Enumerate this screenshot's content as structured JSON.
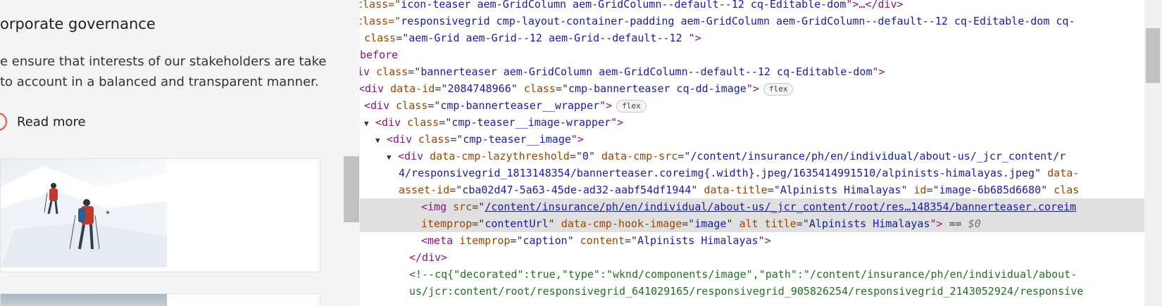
{
  "page": {
    "heading": "orporate governance",
    "paragraph_lines": [
      "e ensure that interests of our stakeholders are taken",
      "to account in a balanced and transparent manner."
    ],
    "read_more": "Read more"
  },
  "devtools": {
    "lines": [
      {
        "parts": [
          {
            "text": "class=\"",
            "cls": "attr"
          },
          {
            "text": "icon-teaser aem-GridColumn aem-GridColumn--default--12 cq-Editable-dom",
            "cls": "val"
          },
          {
            "text": "\">…</div>",
            "cls": "tag"
          }
        ]
      },
      {
        "parts": [
          {
            "text": "class=\"",
            "cls": "attr"
          },
          {
            "text": "responsivegrid cmp-layout-container-padding aem-GridColumn aem-GridColumn--default--12 cq-Editable-dom cq-",
            "cls": "val"
          }
        ]
      },
      {
        "parts": [
          {
            "text": "v ",
            "cls": "tag"
          },
          {
            "text": "class",
            "cls": "attr"
          },
          {
            "text": "=\"",
            "cls": "plain"
          },
          {
            "text": "aem-Grid aem-Grid--12 aem-Grid--default--12 ",
            "cls": "val"
          },
          {
            "text": "\">",
            "cls": "tag"
          }
        ]
      },
      {
        "parts": [
          {
            "text": "before",
            "cls": "pseudo"
          }
        ]
      },
      {
        "parts": [
          {
            "text": "iv ",
            "cls": "tag"
          },
          {
            "text": "class",
            "cls": "attr"
          },
          {
            "text": "=\"",
            "cls": "plain"
          },
          {
            "text": "bannerteaser aem-GridColumn aem-GridColumn--default--12 cq-Editable-dom",
            "cls": "val"
          },
          {
            "text": "\">",
            "cls": "tag"
          }
        ]
      },
      {
        "parts": [
          {
            "text": "<div ",
            "cls": "tag"
          },
          {
            "text": "data-id",
            "cls": "attr"
          },
          {
            "text": "=\"",
            "cls": "plain"
          },
          {
            "text": "2084748966",
            "cls": "val"
          },
          {
            "text": "\" ",
            "cls": "plain"
          },
          {
            "text": "class",
            "cls": "attr"
          },
          {
            "text": "=\"",
            "cls": "plain"
          },
          {
            "text": "cmp-bannerteaser cq-dd-image",
            "cls": "val"
          },
          {
            "text": "\">",
            "cls": "tag"
          }
        ],
        "badge": "flex"
      },
      {
        "tri": "▼",
        "parts": [
          {
            "text": "<div ",
            "cls": "tag"
          },
          {
            "text": "class",
            "cls": "attr"
          },
          {
            "text": "=\"",
            "cls": "plain"
          },
          {
            "text": "cmp-bannerteaser__wrapper",
            "cls": "val"
          },
          {
            "text": "\">",
            "cls": "tag"
          }
        ],
        "badge": "flex"
      },
      {
        "tri": "▼",
        "parts": [
          {
            "text": "<div ",
            "cls": "tag"
          },
          {
            "text": "class",
            "cls": "attr"
          },
          {
            "text": "=\"",
            "cls": "plain"
          },
          {
            "text": "cmp-teaser__image-wrapper",
            "cls": "val"
          },
          {
            "text": "\">",
            "cls": "tag"
          }
        ]
      },
      {
        "tri": "▼",
        "parts": [
          {
            "text": "<div ",
            "cls": "tag"
          },
          {
            "text": "class",
            "cls": "attr"
          },
          {
            "text": "=\"",
            "cls": "plain"
          },
          {
            "text": "cmp-teaser__image",
            "cls": "val"
          },
          {
            "text": "\">",
            "cls": "tag"
          }
        ]
      },
      {
        "tri": "▼",
        "parts": [
          {
            "text": "<div ",
            "cls": "tag"
          },
          {
            "text": "data-cmp-lazythreshold",
            "cls": "attr"
          },
          {
            "text": "=\"",
            "cls": "plain"
          },
          {
            "text": "0",
            "cls": "val"
          },
          {
            "text": "\" ",
            "cls": "plain"
          },
          {
            "text": "data-cmp-src",
            "cls": "attr"
          },
          {
            "text": "=\"",
            "cls": "plain"
          },
          {
            "text": "/content/insurance/ph/en/individual/about-us/_jcr_content/r",
            "cls": "val"
          }
        ]
      },
      {
        "parts": [
          {
            "text": "4/responsivegrid_1813148354/bannerteaser.coreimg{.width}.jpeg/1635414991510/alpinists-himalayas.jpeg",
            "cls": "val"
          },
          {
            "text": "\" ",
            "cls": "plain"
          },
          {
            "text": "data-",
            "cls": "attr"
          }
        ]
      },
      {
        "parts": [
          {
            "text": "asset-id",
            "cls": "attr"
          },
          {
            "text": "=\"",
            "cls": "plain"
          },
          {
            "text": "cba02d47-5a63-45de-ad32-aabf54df1944",
            "cls": "val"
          },
          {
            "text": "\" ",
            "cls": "plain"
          },
          {
            "text": "data-title",
            "cls": "attr"
          },
          {
            "text": "=\"",
            "cls": "plain"
          },
          {
            "text": "Alpinists Himalayas",
            "cls": "val"
          },
          {
            "text": "\" ",
            "cls": "plain"
          },
          {
            "text": "id",
            "cls": "attr"
          },
          {
            "text": "=\"",
            "cls": "plain"
          },
          {
            "text": "image-6b685d6680",
            "cls": "val"
          },
          {
            "text": "\" ",
            "cls": "plain"
          },
          {
            "text": "clas",
            "cls": "attr"
          }
        ]
      },
      {
        "selected": true,
        "parts": [
          {
            "text": "<img ",
            "cls": "tag"
          },
          {
            "text": "src",
            "cls": "attr"
          },
          {
            "text": "=\"",
            "cls": "plain"
          },
          {
            "text": "/content/insurance/ph/en/individual/about-us/_jcr_content/root/res…148354/bannerteaser.coreim",
            "cls": "link"
          }
        ]
      },
      {
        "selected": true,
        "parts": [
          {
            "text": "itemprop",
            "cls": "attr"
          },
          {
            "text": "=\"",
            "cls": "plain"
          },
          {
            "text": "contentUrl",
            "cls": "val"
          },
          {
            "text": "\" ",
            "cls": "plain"
          },
          {
            "text": "data-cmp-hook-image",
            "cls": "attr"
          },
          {
            "text": "=\"",
            "cls": "plain"
          },
          {
            "text": "image",
            "cls": "val"
          },
          {
            "text": "\" ",
            "cls": "plain"
          },
          {
            "text": "alt title",
            "cls": "attr"
          },
          {
            "text": "=\"",
            "cls": "plain"
          },
          {
            "text": "Alpinists Himalayas",
            "cls": "val"
          },
          {
            "text": "\"> ",
            "cls": "tag"
          },
          {
            "text": "== ",
            "cls": "plain"
          },
          {
            "text": "$0",
            "cls": "ref"
          }
        ]
      },
      {
        "parts": [
          {
            "text": "<meta ",
            "cls": "tag"
          },
          {
            "text": "itemprop",
            "cls": "attr"
          },
          {
            "text": "=\"",
            "cls": "plain"
          },
          {
            "text": "caption",
            "cls": "val"
          },
          {
            "text": "\" ",
            "cls": "plain"
          },
          {
            "text": "content",
            "cls": "attr"
          },
          {
            "text": "=\"",
            "cls": "plain"
          },
          {
            "text": "Alpinists Himalayas",
            "cls": "val"
          },
          {
            "text": "\">",
            "cls": "tag"
          }
        ]
      },
      {
        "parts": [
          {
            "text": "</div>",
            "cls": "tag"
          }
        ]
      },
      {
        "parts": [
          {
            "text": "<!--cq{\"decorated\":true,\"type\":\"wknd/components/image\",\"path\":\"/content/insurance/ph/en/individual/about-",
            "cls": "comment"
          }
        ]
      },
      {
        "parts": [
          {
            "text": "us/jcr:content/root/responsivegrid_641029165/responsivegrid_905826254/responsivegrid_2143052924/responsive",
            "cls": "comment"
          }
        ]
      }
    ]
  },
  "colors": {
    "accent": "#e84b3c",
    "page_background": "#f4f4f4",
    "selected_row": "#e0e0e0"
  }
}
